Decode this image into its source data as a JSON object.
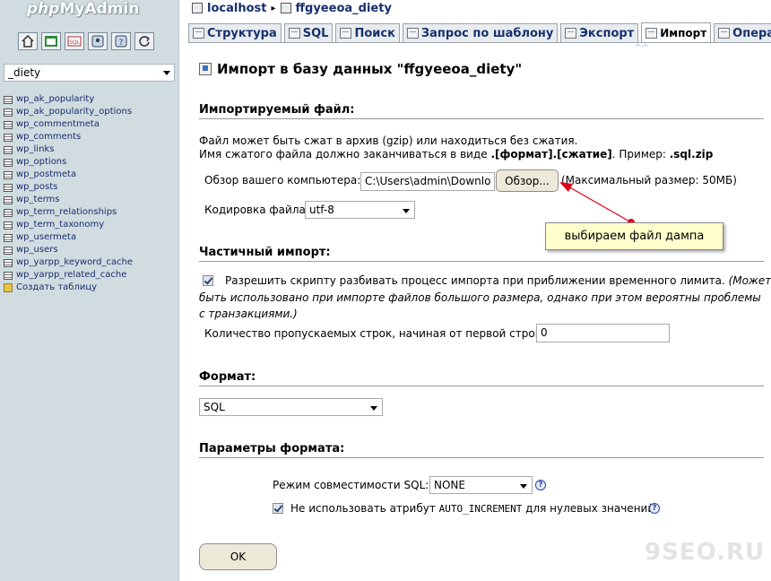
{
  "sidebar": {
    "logo_php": "php",
    "logo_myadmin": "MyAdmin",
    "quick_icons": [
      "home-icon",
      "query-window-icon",
      "sql-icon",
      "docs-icon",
      "help-icon",
      "reload-icon"
    ],
    "db_selected": "_diety",
    "tables": [
      "wp_ak_popularity",
      "wp_ak_popularity_options",
      "wp_commentmeta",
      "wp_comments",
      "wp_links",
      "wp_options",
      "wp_postmeta",
      "wp_posts",
      "wp_terms",
      "wp_term_relationships",
      "wp_term_taxonomy",
      "wp_usermeta",
      "wp_users",
      "wp_yarpp_keyword_cache",
      "wp_yarpp_related_cache"
    ],
    "create_table": "Создать таблицу"
  },
  "breadcrumb": {
    "server": "localhost",
    "database": "ffgyeeoa_diety"
  },
  "tabs": {
    "structure": "Структура",
    "sql": "SQL",
    "search": "Поиск",
    "query": "Запрос по шаблону",
    "export": "Экспорт",
    "import": "Импорт",
    "operations": "Операции"
  },
  "page": {
    "title": "Импорт в базу данных \"ffgyeeoa_diety\"",
    "file_section": {
      "heading": "Импортируемый файл:",
      "desc_line1": "Файл может быть сжат в архив (gzip) или находиться без сжатия.",
      "desc_line2_prefix": "Имя сжатого файла должно заканчиваться в виде ",
      "desc_line2_format": ".[формат].[сжатие]",
      "desc_line2_mid": ". Пример: ",
      "desc_line2_example": ".sql.zip",
      "browse_label": "Обзор вашего компьютера:",
      "file_path": "C:\\Users\\admin\\Downlo",
      "browse_button": "Обзор...",
      "max_size": "(Максимальный размер: 50МБ)",
      "charset_label": "Кодировка файла:",
      "charset_value": "utf-8"
    },
    "partial_section": {
      "heading": "Частичный импорт:",
      "allow_interrupt_main": "Разрешить скрипту разбивать процесс импорта при приближении временного лимита.",
      "allow_interrupt_note1": " (Может",
      "allow_interrupt_note2": "быть использовано при импорте файлов большого размера, однако при этом вероятны проблемы",
      "allow_interrupt_note3": "с транзакциями.)",
      "skip_label": "Количество пропускаемых строк, начиная от первой строки:",
      "skip_value": "0"
    },
    "format_section": {
      "heading": "Формат:",
      "format_value": "SQL"
    },
    "options_section": {
      "heading": "Параметры формата:",
      "compat_label": "Режим совместимости SQL:",
      "compat_value": "NONE",
      "no_auto_prefix": "Не использовать атрибут ",
      "no_auto_code": "AUTO_INCREMENT",
      "no_auto_suffix": " для нулевых значений"
    },
    "ok_button": "OK"
  },
  "annotation": {
    "callout": "выбираем файл дампа",
    "arrow_color": "#e0001a"
  },
  "watermark": "9SEO.RU",
  "colors": {
    "sidebar_bg": "#d0dce0",
    "link": "#17306e",
    "callout_bg": "#ffffcc"
  }
}
